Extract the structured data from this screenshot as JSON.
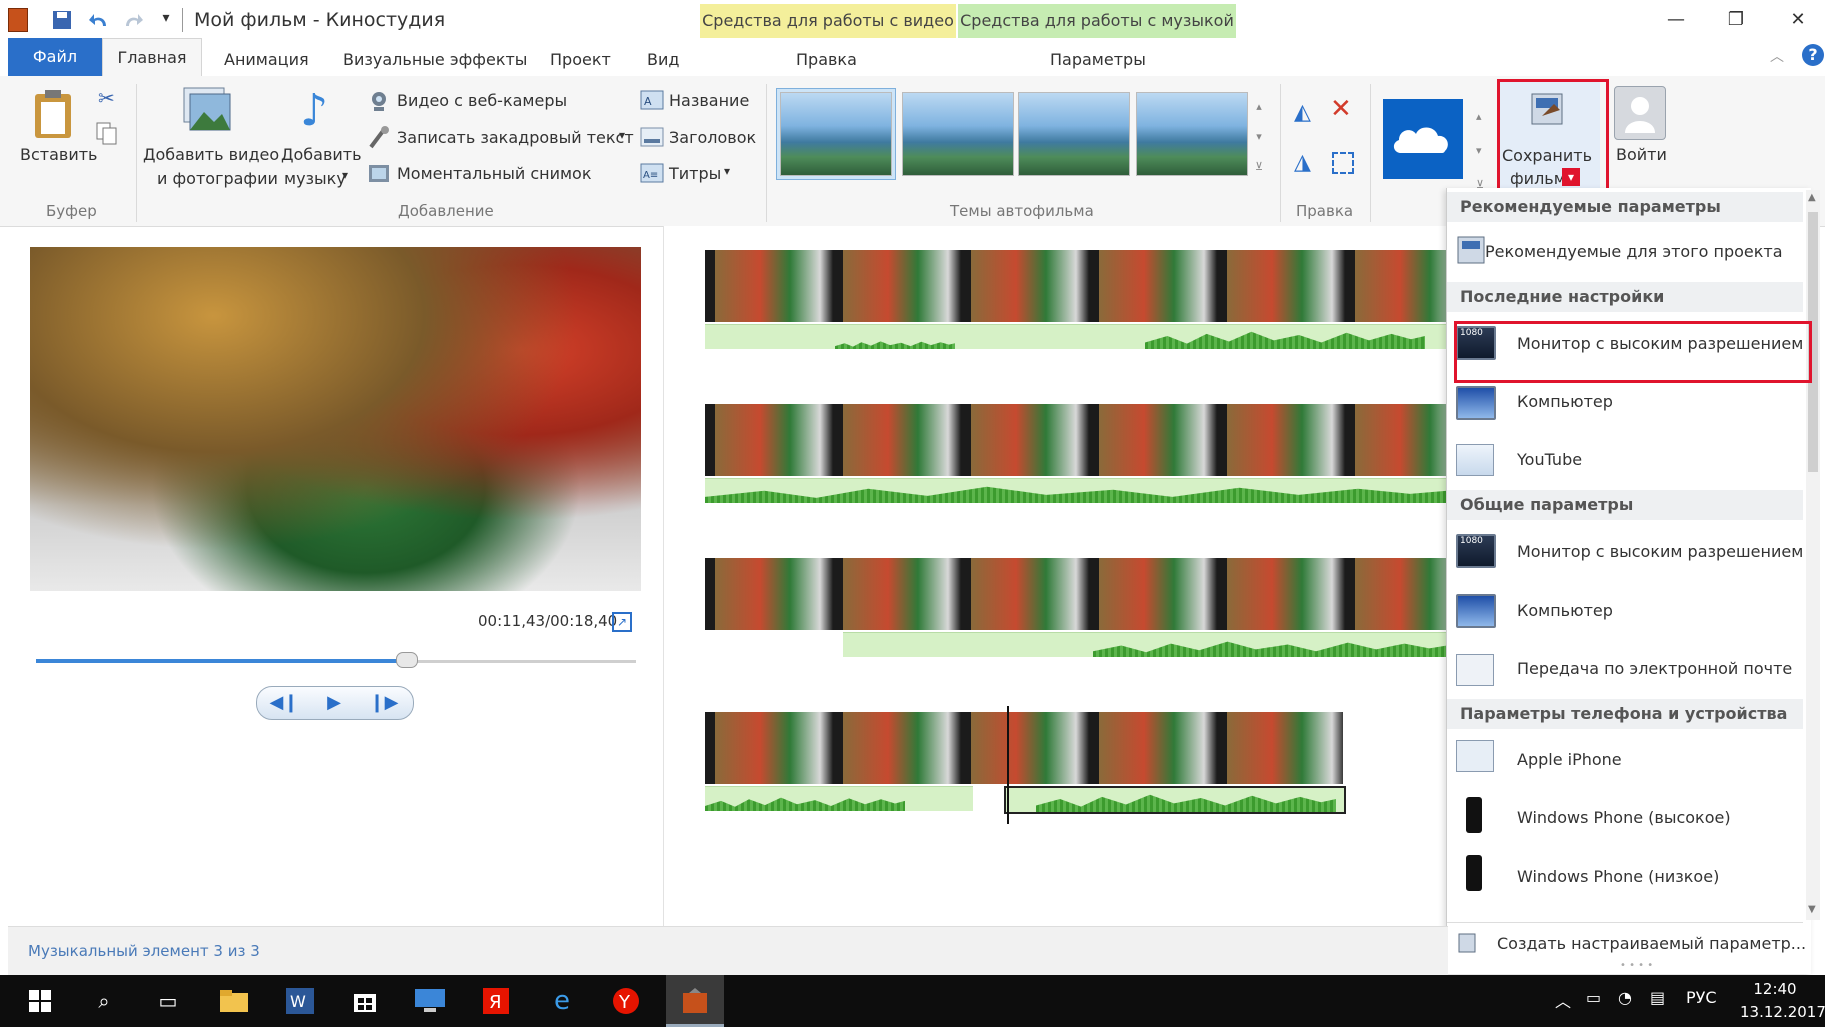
{
  "window": {
    "title": "Мой фильм - Киностудия",
    "context_video": "Средства для работы с видео",
    "context_music": "Средства для работы с музыкой",
    "context_video_tab": "Правка",
    "context_music_tab": "Параметры"
  },
  "tabs": [
    "Файл",
    "Главная",
    "Анимация",
    "Визуальные эффекты",
    "Проект",
    "Вид"
  ],
  "ribbon": {
    "paste": "Вставить",
    "buffer_group": "Буфер",
    "add_video_1": "Добавить видео",
    "add_video_2": "и фотографии",
    "add_music_1": "Добавить",
    "add_music_2": "музыку",
    "webcam": "Видео с веб-камеры",
    "narration": "Записать закадровый текст",
    "snapshot": "Моментальный снимок",
    "title_btn": "Название",
    "caption_btn": "Заголовок",
    "credits_btn": "Титры",
    "add_group": "Добавление",
    "themes_group": "Темы автофильма",
    "edit_group": "Правка",
    "save_movie_1": "Сохранить",
    "save_movie_2": "фильм",
    "sign_in": "Войти"
  },
  "preview": {
    "time": "00:11,43/00:18,40",
    "position_fraction": 0.62
  },
  "menu": {
    "section_recommended": "Рекомендуемые параметры",
    "recommended_item": "Рекомендуемые для этого проекта",
    "section_recent": "Последние настройки",
    "recent_items": [
      "Монитор с высоким разрешением",
      "Компьютер",
      "YouTube"
    ],
    "section_common": "Общие параметры",
    "common_items": [
      "Монитор с высоким разрешением",
      "Компьютер",
      "Передача по электронной почте"
    ],
    "section_devices": "Параметры телефона и устройства",
    "device_items": [
      "Apple iPhone",
      "Windows Phone (высокое)",
      "Windows Phone (низкое)"
    ],
    "custom": "Создать настраиваемый параметр...",
    "badge_1080": "1080"
  },
  "status": {
    "text": "Музыкальный элемент 3 из 3"
  },
  "taskbar": {
    "lang": "РУС",
    "time": "12:40",
    "date": "13.12.2017"
  },
  "colors": {
    "accent": "#2a6fc9",
    "highlight": "#e0142d",
    "context_video": "#f4ef9b",
    "context_music": "#c6ecb2"
  },
  "icons": [
    "app-icon",
    "save-icon",
    "undo-icon",
    "redo-icon",
    "customize-icon",
    "minimize-icon",
    "restore-icon",
    "close-icon",
    "help-icon",
    "paste-icon",
    "cut-icon",
    "copy-icon",
    "webcam-icon",
    "microphone-icon",
    "snapshot-icon",
    "title-icon",
    "caption-icon",
    "credits-icon",
    "rotate-left-icon",
    "rotate-right-icon",
    "remove-icon",
    "select-all-icon",
    "onedrive-icon",
    "save-movie-icon",
    "user-icon",
    "windows-start-icon",
    "search-icon",
    "task-view-icon",
    "folder-icon",
    "word-icon",
    "store-icon",
    "computer-icon",
    "yandex-icon",
    "edge-icon",
    "yandex-browser-icon",
    "movie-maker-icon"
  ]
}
